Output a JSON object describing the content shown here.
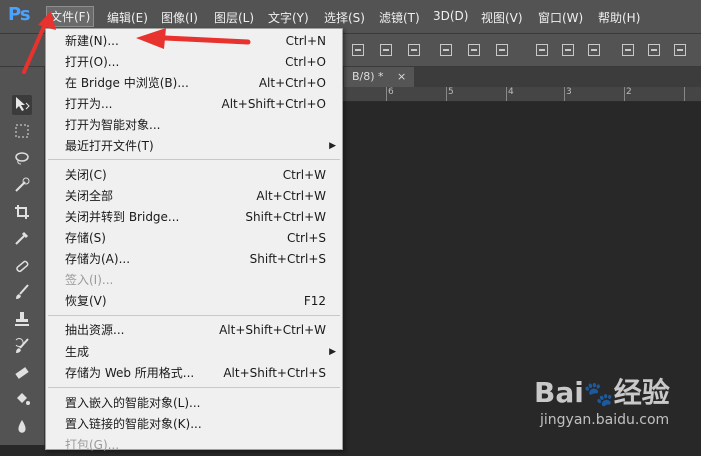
{
  "app": {
    "logo": "Ps"
  },
  "menubar": {
    "items": [
      {
        "label": "文件(F)",
        "active": true
      },
      {
        "label": "编辑(E)"
      },
      {
        "label": "图像(I)"
      },
      {
        "label": "图层(L)"
      },
      {
        "label": "文字(Y)"
      },
      {
        "label": "选择(S)"
      },
      {
        "label": "滤镜(T)"
      },
      {
        "label": "3D(D)"
      },
      {
        "label": "视图(V)"
      },
      {
        "label": "窗口(W)"
      },
      {
        "label": "帮助(H)"
      }
    ]
  },
  "document": {
    "tab_label": "B/8) *",
    "close_glyph": "×"
  },
  "ruler": {
    "ticks": [
      "6",
      "5",
      "4",
      "3",
      "2"
    ]
  },
  "file_menu": {
    "items": [
      {
        "label": "新建(N)...",
        "shortcut": "Ctrl+N"
      },
      {
        "label": "打开(O)...",
        "shortcut": "Ctrl+O"
      },
      {
        "label": "在 Bridge 中浏览(B)...",
        "shortcut": "Alt+Ctrl+O"
      },
      {
        "label": "打开为...",
        "shortcut": "Alt+Shift+Ctrl+O"
      },
      {
        "label": "打开为智能对象...",
        "shortcut": ""
      },
      {
        "label": "最近打开文件(T)",
        "shortcut": "",
        "submenu": true
      },
      {
        "label": "关闭(C)",
        "shortcut": "Ctrl+W"
      },
      {
        "label": "关闭全部",
        "shortcut": "Alt+Ctrl+W"
      },
      {
        "label": "关闭并转到 Bridge...",
        "shortcut": "Shift+Ctrl+W"
      },
      {
        "label": "存储(S)",
        "shortcut": "Ctrl+S"
      },
      {
        "label": "存储为(A)...",
        "shortcut": "Shift+Ctrl+S"
      },
      {
        "label": "签入(I)...",
        "shortcut": "",
        "disabled": true
      },
      {
        "label": "恢复(V)",
        "shortcut": "F12"
      },
      {
        "label": "抽出资源...",
        "shortcut": "Alt+Shift+Ctrl+W"
      },
      {
        "label": "生成",
        "shortcut": "",
        "submenu": true
      },
      {
        "label": "存储为 Web 所用格式...",
        "shortcut": "Alt+Shift+Ctrl+S"
      },
      {
        "label": "置入嵌入的智能对象(L)...",
        "shortcut": ""
      },
      {
        "label": "置入链接的智能对象(K)...",
        "shortcut": ""
      },
      {
        "label": "打包(G)...",
        "shortcut": "",
        "disabled": true
      }
    ]
  },
  "watermark": {
    "brand": "Bai",
    "brand_cn": "经验",
    "url": "jingyan.baidu.com"
  },
  "colors": {
    "accent": "#4aa3ff",
    "annotation": "#e8322e",
    "menu_bg": "#f0f0f0"
  }
}
